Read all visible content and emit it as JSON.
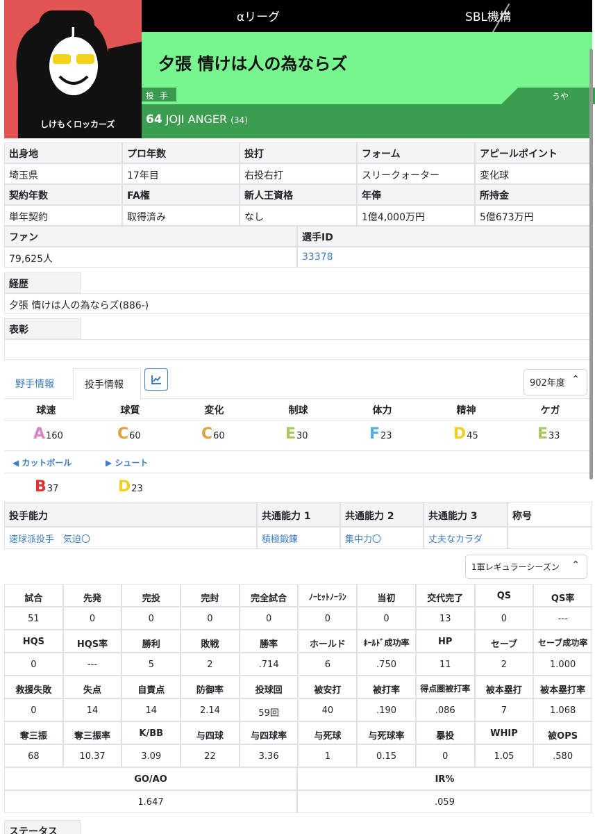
{
  "header": {
    "league": "αリーグ",
    "org": "SBL機構",
    "team": "夕張 情けは人の為ならズ",
    "position": "投 手",
    "owner": "うや",
    "number": "64",
    "name": "JOJI ANGER",
    "age": "(34)",
    "avatar_caption": "しけもくロッカーズ"
  },
  "info": {
    "r1": [
      {
        "h": "出身地",
        "v": "埼玉県"
      },
      {
        "h": "プロ年数",
        "v": "17年目"
      },
      {
        "h": "投打",
        "v": "右投右打"
      },
      {
        "h": "フォーム",
        "v": "スリークォーター"
      },
      {
        "h": "アピールポイント",
        "v": "変化球"
      }
    ],
    "r2": [
      {
        "h": "契約年数",
        "v": "単年契約"
      },
      {
        "h": "FA権",
        "v": "取得済み"
      },
      {
        "h": "新人王資格",
        "v": "なし"
      },
      {
        "h": "年俸",
        "v": "1億4,000万円"
      },
      {
        "h": "所持金",
        "v": "5億673万円"
      }
    ],
    "fan_h": "ファン",
    "fan_v": "79,625人",
    "id_h": "選手ID",
    "id_v": "33378",
    "career_h": "経歴",
    "career_v": "夕張 情けは人の為ならズ(886-)",
    "award_h": "表彰"
  },
  "tabs": {
    "fielder": "野手情報",
    "pitcher": "投手情報",
    "year": "902年度",
    "season": "1軍レギュラーシーズン"
  },
  "abilities": [
    {
      "h": "球速",
      "g": "A",
      "v": "160",
      "c": "#d882c8"
    },
    {
      "h": "球質",
      "g": "C",
      "v": "60",
      "c": "#e0a040"
    },
    {
      "h": "変化",
      "g": "C",
      "v": "60",
      "c": "#e0a040"
    },
    {
      "h": "制球",
      "g": "E",
      "v": "30",
      "c": "#a8c860"
    },
    {
      "h": "体力",
      "g": "F",
      "v": "23",
      "c": "#5aaedc"
    },
    {
      "h": "精神",
      "g": "D",
      "v": "45",
      "c": "#f0d020"
    },
    {
      "h": "ケガ",
      "g": "E",
      "v": "33",
      "c": "#a8c860"
    }
  ],
  "pitches": [
    {
      "n": "カットボール",
      "arrow": "◀",
      "g": "B",
      "v": "37",
      "c": "#e03030"
    },
    {
      "n": "シュート",
      "arrow": "▶",
      "g": "D",
      "v": "23",
      "c": "#f0d020"
    }
  ],
  "skills": {
    "h": [
      "投手能力",
      "共通能力 1",
      "共通能力 2",
      "共通能力 3",
      "称号"
    ],
    "v": [
      "速球派投手　気迫〇",
      "積極鍛錬",
      "集中力〇",
      "丈夫なカラダ",
      ""
    ]
  },
  "stats": [
    {
      "h": [
        "試合",
        "先発",
        "完投",
        "完封",
        "完全試合",
        "ﾉｰﾋｯﾄﾉｰﾗﾝ",
        "当初",
        "交代完了",
        "QS",
        "QS率"
      ],
      "v": [
        "51",
        "0",
        "0",
        "0",
        "0",
        "0",
        "0",
        "13",
        "0",
        "---"
      ]
    },
    {
      "h": [
        "HQS",
        "HQS率",
        "勝利",
        "敗戦",
        "勝率",
        "ホールド",
        "ﾎｰﾙﾄﾞ成功率",
        "HP",
        "セーブ",
        "セーブ成功率"
      ],
      "v": [
        "0",
        "---",
        "5",
        "2",
        ".714",
        "6",
        ".750",
        "11",
        "2",
        "1.000"
      ]
    },
    {
      "h": [
        "救援失敗",
        "失点",
        "自責点",
        "防御率",
        "投球回",
        "被安打",
        "被打率",
        "得点圏被打率",
        "被本塁打",
        "被本塁打率"
      ],
      "v": [
        "0",
        "14",
        "14",
        "2.14",
        "59回",
        "40",
        ".190",
        ".086",
        "7",
        "1.068"
      ]
    },
    {
      "h": [
        "奪三振",
        "奪三振率",
        "K/BB",
        "与四球",
        "与四球率",
        "与死球",
        "与死球率",
        "暴投",
        "WHIP",
        "被OPS"
      ],
      "v": [
        "68",
        "10.37",
        "3.09",
        "22",
        "3.36",
        "1",
        "0.15",
        "0",
        "1.05",
        ".580"
      ]
    }
  ],
  "goao": {
    "h1": "GO/AO",
    "v1": "1.647",
    "h2": "IR%",
    "v2": ".059"
  },
  "status_h": "ステータス"
}
